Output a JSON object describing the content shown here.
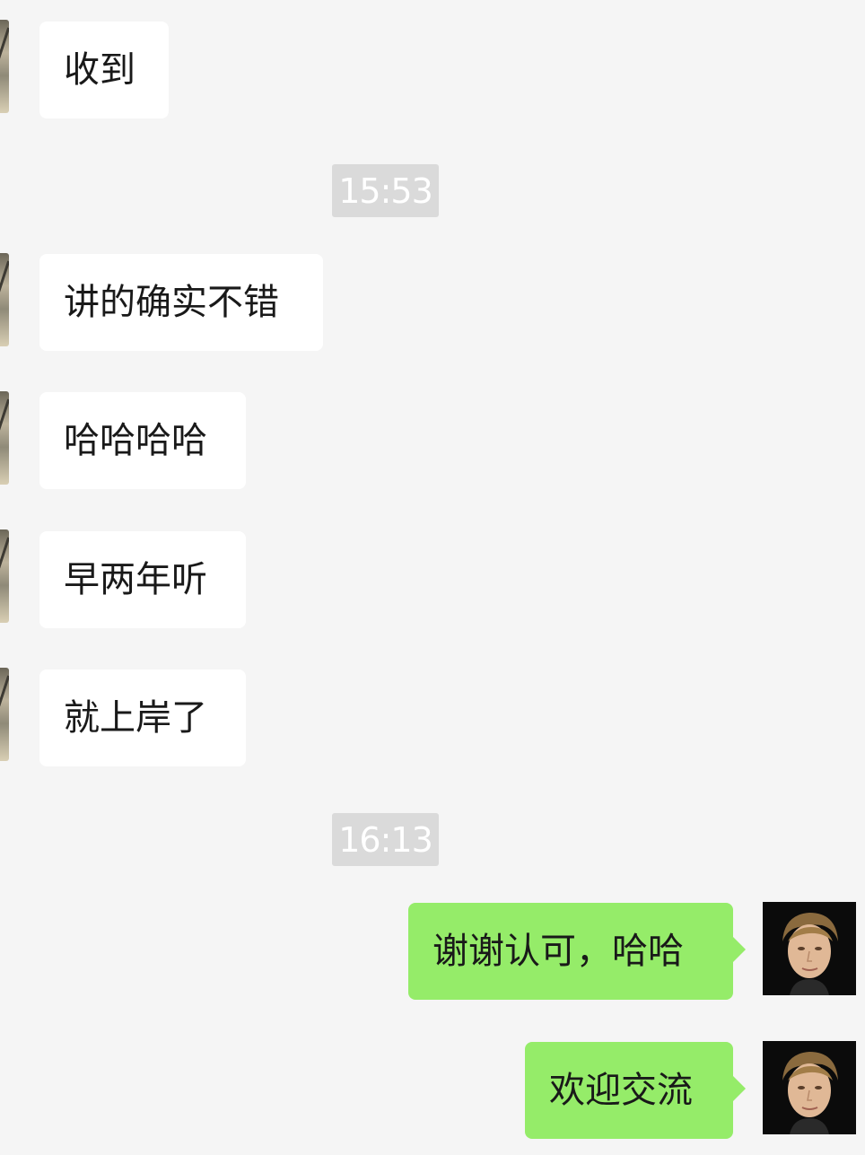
{
  "messages": [
    {
      "side": "in",
      "text": "收到"
    },
    {
      "type": "time",
      "text": "15:53"
    },
    {
      "side": "in",
      "text": "讲的确实不错"
    },
    {
      "side": "in",
      "text": "哈哈哈哈"
    },
    {
      "side": "in",
      "text": "早两年听"
    },
    {
      "side": "in",
      "text": "就上岸了"
    },
    {
      "type": "time",
      "text": "16:13"
    },
    {
      "side": "out",
      "text": "谢谢认可，哈哈"
    },
    {
      "side": "out",
      "text": "欢迎交流"
    }
  ],
  "colors": {
    "background": "#f5f5f5",
    "incoming_bubble": "#ffffff",
    "outgoing_bubble": "#95ec69",
    "timestamp_bg": "#dadada",
    "timestamp_text": "#ffffff"
  },
  "icons": {
    "contact_avatar": "contact-avatar-icon",
    "self_avatar": "self-avatar-icon"
  }
}
